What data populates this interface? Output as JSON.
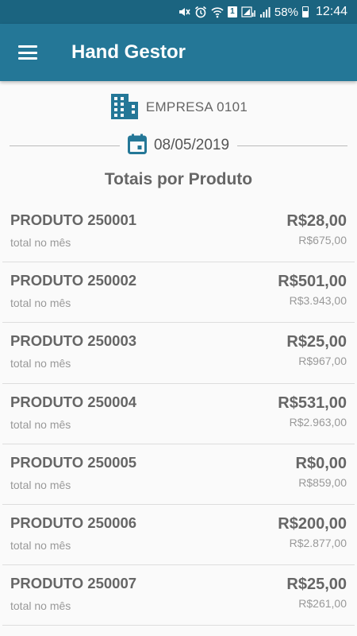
{
  "status_bar": {
    "icons": [
      "mute-icon",
      "alarm-icon",
      "wifi-icon",
      "sim-icon",
      "signal-icon",
      "battery-icon"
    ],
    "sim_label": "1",
    "battery": "58%",
    "time": "12:44"
  },
  "app_bar": {
    "title": "Hand Gestor",
    "menu_icon": "menu-icon"
  },
  "company": {
    "icon": "building-icon",
    "label": "EMPRESA 0101"
  },
  "date": {
    "icon": "calendar-icon",
    "value": "08/05/2019"
  },
  "section_title": "Totais por Produto",
  "products": [
    {
      "name": "PRODUTO 250001",
      "sub": "total no mês",
      "value": "R$28,00",
      "month_total": "R$675,00"
    },
    {
      "name": "PRODUTO 250002",
      "sub": "total no mês",
      "value": "R$501,00",
      "month_total": "R$3.943,00"
    },
    {
      "name": "PRODUTO 250003",
      "sub": "total no mês",
      "value": "R$25,00",
      "month_total": "R$967,00"
    },
    {
      "name": "PRODUTO 250004",
      "sub": "total no mês",
      "value": "R$531,00",
      "month_total": "R$2.963,00"
    },
    {
      "name": "PRODUTO 250005",
      "sub": "total no mês",
      "value": "R$0,00",
      "month_total": "R$859,00"
    },
    {
      "name": "PRODUTO 250006",
      "sub": "total no mês",
      "value": "R$200,00",
      "month_total": "R$2.877,00"
    },
    {
      "name": "PRODUTO 250007",
      "sub": "total no mês",
      "value": "R$25,00",
      "month_total": "R$261,00"
    }
  ],
  "colors": {
    "status_bar": "#1b6480",
    "app_bar": "#247797",
    "accent_icon": "#247797",
    "background": "#fafafa"
  }
}
